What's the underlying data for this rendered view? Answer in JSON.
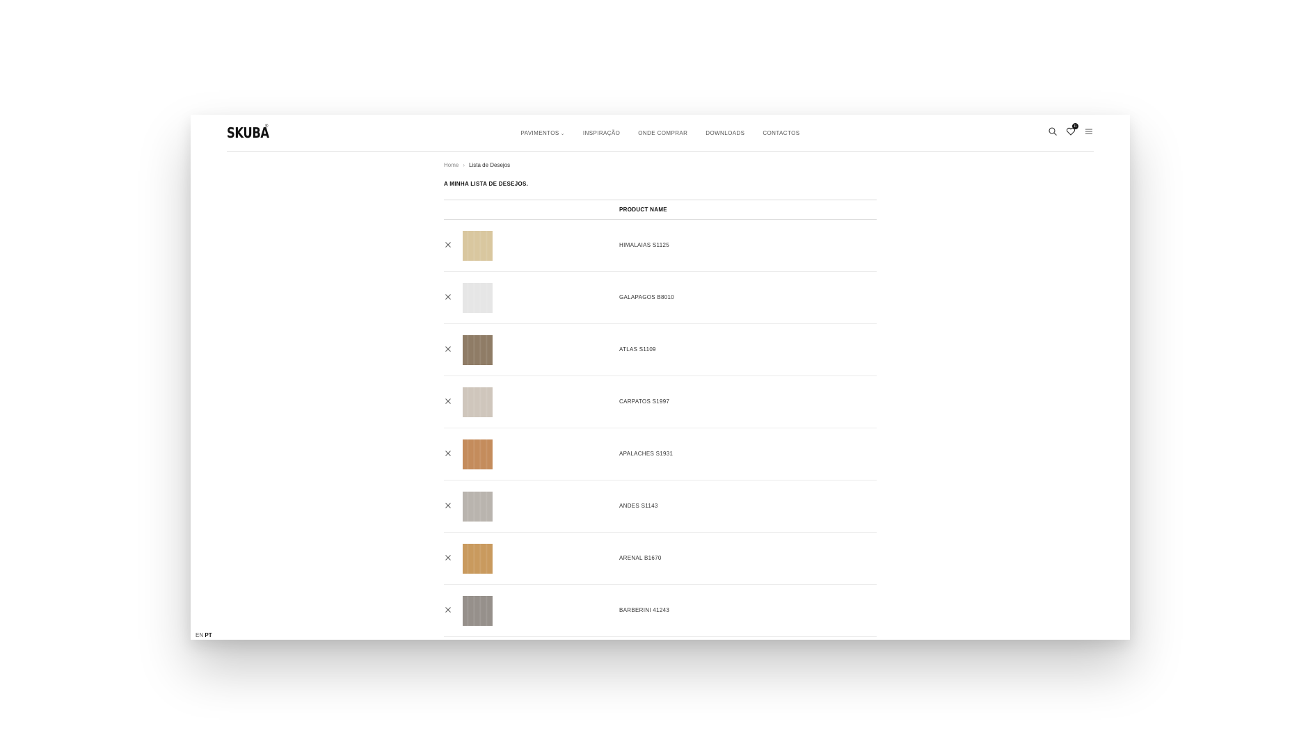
{
  "header": {
    "logo": "SKUBA",
    "logo_mark": "®",
    "nav": [
      {
        "label": "PAVIMENTOS",
        "dropdown": true
      },
      {
        "label": "INSPIRAÇÃO",
        "dropdown": false
      },
      {
        "label": "ONDE COMPRAR",
        "dropdown": false
      },
      {
        "label": "DOWNLOADS",
        "dropdown": false
      },
      {
        "label": "CONTACTOS",
        "dropdown": false
      }
    ],
    "wishlist_count": "11",
    "icons": [
      "search-icon",
      "heart-icon",
      "menu-icon"
    ]
  },
  "breadcrumb": {
    "home": "Home",
    "current": "Lista de Desejos"
  },
  "page": {
    "title": "A MINHA LISTA DE DESEJOS.",
    "column_product_name": "PRODUCT NAME"
  },
  "wishlist": [
    {
      "name": "HIMALAIAS S1125",
      "swatch": "#d9c79f"
    },
    {
      "name": "GALAPAGOS B8010",
      "swatch": "#e6e6e6"
    },
    {
      "name": "ATLAS S1109",
      "swatch": "#8f7c66"
    },
    {
      "name": "CARPATOS S1997",
      "swatch": "#cfc6bc"
    },
    {
      "name": "APALACHES S1931",
      "swatch": "#c48c5c"
    },
    {
      "name": "ANDES S1143",
      "swatch": "#b9b4ae"
    },
    {
      "name": "ARENAL B1670",
      "swatch": "#c99a5e"
    },
    {
      "name": "BARBERINI 41243",
      "swatch": "#96908b"
    }
  ],
  "footer": {
    "lang_en": "EN",
    "lang_pt": "PT"
  },
  "colors": {
    "text": "#111111",
    "muted": "#888888",
    "border": "#dcdcdc"
  }
}
